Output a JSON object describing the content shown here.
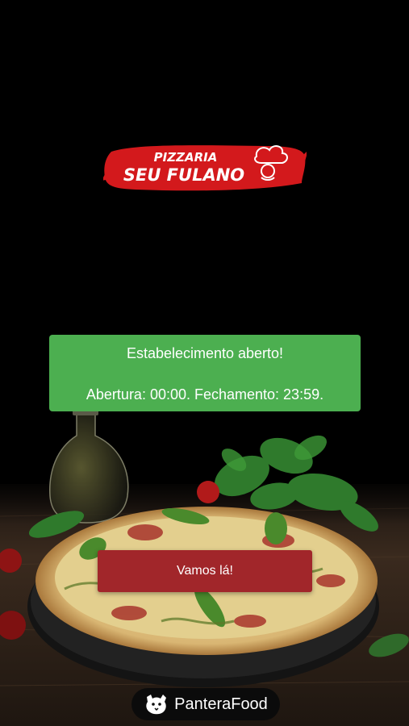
{
  "logo": {
    "line1": "PIZZARIA",
    "line2": "SEU FULANO",
    "icon": "chef-hat-icon"
  },
  "status": {
    "title": "Estabelecimento aberto!",
    "hours": "Abertura: 00:00. Fechamento: 23:59."
  },
  "cta": {
    "label": "Vamos lá!"
  },
  "brand": {
    "name": "PanteraFood",
    "icon": "panther-icon"
  },
  "colors": {
    "status_green": "#4caf50",
    "button_red": "#a1262a",
    "logo_red": "#d3191c",
    "background": "#000000"
  }
}
